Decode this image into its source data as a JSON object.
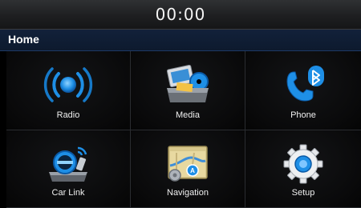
{
  "status": {
    "clock": "00:00"
  },
  "header": {
    "title": "Home"
  },
  "menu": {
    "items": [
      {
        "label": "Radio",
        "icon": "radio-icon"
      },
      {
        "label": "Media",
        "icon": "media-icon"
      },
      {
        "label": "Phone",
        "icon": "phone-bluetooth-icon"
      },
      {
        "label": "Car Link",
        "icon": "car-link-icon"
      },
      {
        "label": "Navigation",
        "icon": "navigation-map-icon"
      },
      {
        "label": "Setup",
        "icon": "gear-icon"
      }
    ]
  },
  "colors": {
    "accent": "#1e8fe6",
    "titlebar": "#0d1a2e",
    "background": "#000000"
  }
}
